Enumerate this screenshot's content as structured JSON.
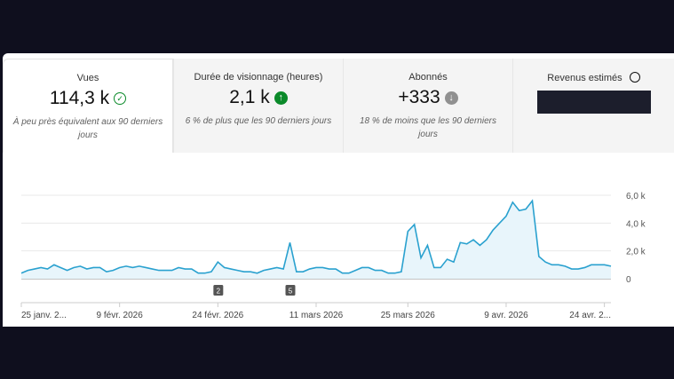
{
  "cards": [
    {
      "label": "Vues",
      "value": "114,3 k",
      "icon": "check-circle-icon",
      "note": "À peu près équivalent aux 90 derniers jours"
    },
    {
      "label": "Durée de visionnage (heures)",
      "value": "2,1 k",
      "icon": "arrow-up-icon",
      "note": "6 % de plus que les 90 derniers jours"
    },
    {
      "label": "Abonnés",
      "value": "+333",
      "icon": "arrow-down-icon",
      "note": "18 % de moins que les 90 derniers jours"
    },
    {
      "label": "Revenus estimés",
      "icon": "clock-icon"
    }
  ],
  "colors": {
    "line": "#2aa1cf",
    "fill": "#e8f5fb",
    "green": "#0b8a2a",
    "grey": "#909090"
  },
  "chart_data": {
    "type": "area",
    "x_ticks": [
      {
        "label": "25 janv. 2...",
        "day": 0
      },
      {
        "label": "9 févr. 2026",
        "day": 15
      },
      {
        "label": "24 févr. 2026",
        "day": 30
      },
      {
        "label": "11 mars 2026",
        "day": 45
      },
      {
        "label": "25 mars 2026",
        "day": 59
      },
      {
        "label": "9 avr. 2026",
        "day": 74
      },
      {
        "label": "24 avr. 2...",
        "day": 89
      }
    ],
    "y_ticks": [
      {
        "label": "0",
        "v": 0
      },
      {
        "label": "2,0 k",
        "v": 2000
      },
      {
        "label": "4,0 k",
        "v": 4000
      },
      {
        "label": "6,0 k",
        "v": 6000
      }
    ],
    "ylim": [
      0,
      6000
    ],
    "values": [
      400,
      600,
      700,
      800,
      700,
      1000,
      800,
      600,
      800,
      900,
      700,
      800,
      800,
      500,
      600,
      800,
      900,
      800,
      900,
      800,
      700,
      600,
      600,
      600,
      800,
      700,
      700,
      400,
      400,
      500,
      1200,
      800,
      700,
      600,
      500,
      500,
      400,
      600,
      700,
      800,
      700,
      2600,
      500,
      500,
      700,
      800,
      800,
      700,
      700,
      400,
      400,
      600,
      800,
      800,
      600,
      600,
      400,
      400,
      500,
      3400,
      3900,
      1500,
      2400,
      800,
      800,
      1400,
      1200,
      2600,
      2500,
      2800,
      2400,
      2800,
      3500,
      4000,
      4500,
      5500,
      4900,
      5000,
      5600,
      1600,
      1200,
      1000,
      1000,
      900,
      700,
      700,
      800,
      1000,
      1000,
      1000,
      900
    ],
    "markers": [
      {
        "label": "2",
        "day": 30
      },
      {
        "label": "5",
        "day": 41
      }
    ]
  }
}
